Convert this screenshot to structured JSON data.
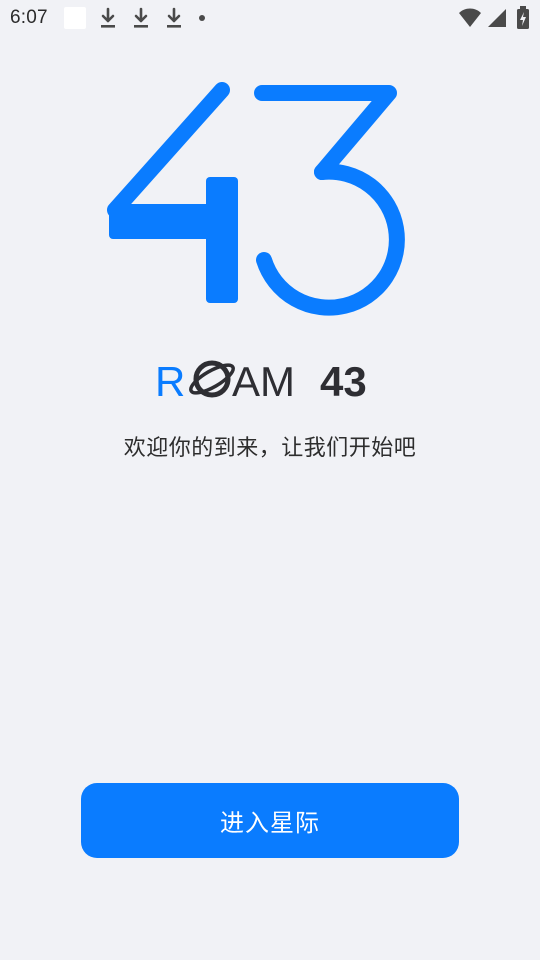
{
  "status_bar": {
    "time": "6:07",
    "left_icons": [
      "notification-square",
      "download-icon",
      "download-icon",
      "download-icon",
      "dot-icon"
    ],
    "right_icons": [
      "wifi-icon",
      "cell-signal-icon",
      "battery-charging-icon"
    ]
  },
  "hero": {
    "number": "43",
    "color": "#0a7cff"
  },
  "brand": {
    "r": "R",
    "am": "AM",
    "num": "43",
    "icon": "planet-icon",
    "accent_color": "#0a7cff",
    "text_color": "#2e2e33"
  },
  "welcome": {
    "text": "欢迎你的到来，让我们开始吧"
  },
  "enter_button": {
    "label": "进入星际",
    "color": "#0a7cff"
  }
}
